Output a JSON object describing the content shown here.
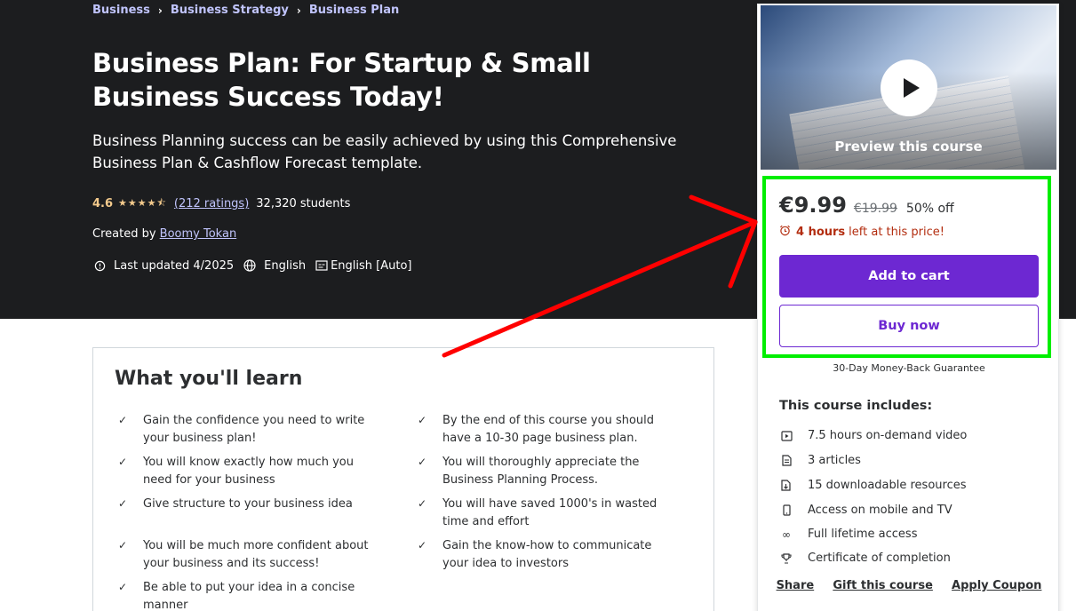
{
  "breadcrumb": [
    "Business",
    "Business Strategy",
    "Business Plan"
  ],
  "course": {
    "title": "Business Plan: For Startup & Small Business Success Today!",
    "subtitle": "Business Planning success can be easily achieved by using this Comprehensive Business Plan & Cashflow Forecast template.",
    "rating": "4.6",
    "ratings_link": "(212 ratings)",
    "students": "32,320 students",
    "created_by_label": "Created by",
    "author": "Boomy Tokan",
    "last_updated": "Last updated 4/2025",
    "language": "English",
    "captions": "English [Auto]"
  },
  "learn": {
    "heading": "What you'll learn",
    "items": [
      "Gain the confidence you need to write your business plan!",
      "By the end of this course you should have a 10-30 page business plan.",
      "You will know exactly how much you need for your business",
      "You will thoroughly appreciate the Business Planning Process.",
      "Give structure to your business idea",
      "You will have saved 1000's in wasted time and effort",
      "You will be much more confident about your business and its success!",
      "Gain the know-how to communicate your idea to investors",
      "Be able to put your idea in a concise manner"
    ]
  },
  "card": {
    "preview_label": "Preview this course",
    "price": "€9.99",
    "original_price": "€19.99",
    "discount": "50% off",
    "timer_bold": "4 hours",
    "timer_rest": "left at this price!",
    "add_to_cart": "Add to cart",
    "buy_now": "Buy now",
    "guarantee": "30-Day Money-Back Guarantee",
    "includes_title": "This course includes:",
    "includes": [
      {
        "icon": "video-icon",
        "text": "7.5 hours on-demand video"
      },
      {
        "icon": "article-icon",
        "text": "3 articles"
      },
      {
        "icon": "download-icon",
        "text": "15 downloadable resources"
      },
      {
        "icon": "mobile-icon",
        "text": "Access on mobile and TV"
      },
      {
        "icon": "infinity-icon",
        "text": "Full lifetime access"
      },
      {
        "icon": "trophy-icon",
        "text": "Certificate of completion"
      }
    ],
    "links": [
      "Share",
      "Gift this course",
      "Apply Coupon"
    ]
  },
  "colors": {
    "hero_bg": "#1c1d1f",
    "accent": "#6d28d2",
    "link": "#c0c4fc",
    "star": "#f3ca8c",
    "timer": "#b32d0f",
    "annotation_green": "#00ee00",
    "annotation_red": "#ff0000"
  }
}
